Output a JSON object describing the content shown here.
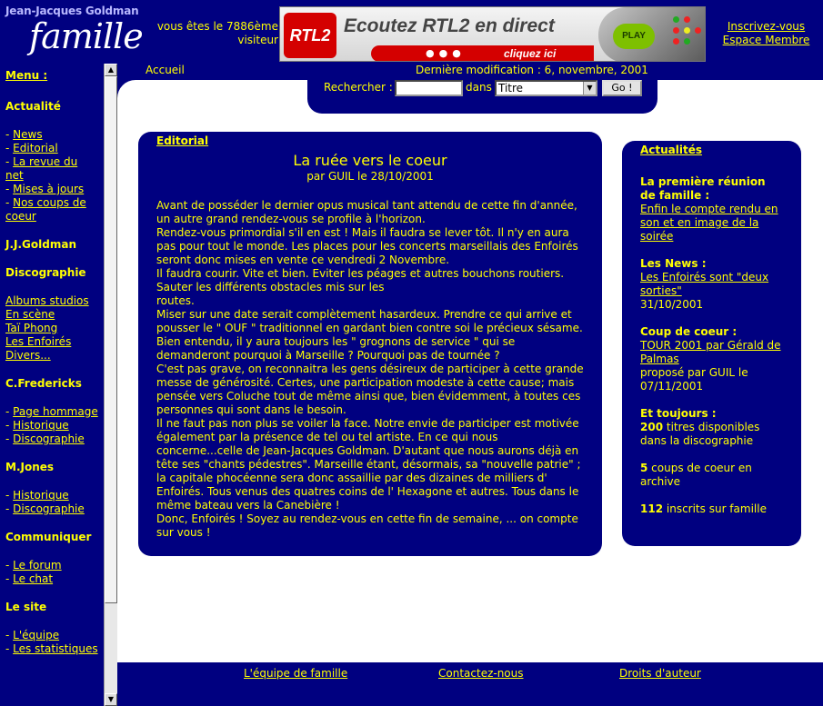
{
  "header": {
    "logo_top": "Jean-Jacques Goldman",
    "logo_main": "famille",
    "visitor_text": "vous êtes le 7886ème visiteur",
    "banner": {
      "logo": "RTL2",
      "headline": "Ecoutez RTL2 en direct",
      "cta": "cliquez ici",
      "play": "PLAY"
    },
    "member_links": [
      "Inscrivez-vous",
      "Espace Membre"
    ]
  },
  "sidebar": {
    "menu_title": "Menu :",
    "sections": [
      {
        "title": "Actualité",
        "items": [
          "News",
          "Editorial",
          "La revue du net",
          "Mises à jours",
          "Nos coups de coeur"
        ]
      },
      {
        "title": "J.J.Goldman",
        "items": []
      },
      {
        "title": "Discographie",
        "items": [
          "Albums studios",
          "En scène",
          "Taï Phong",
          "Les Enfoirés",
          "Divers..."
        ]
      },
      {
        "title": "C.Fredericks",
        "items": [
          "Page hommage",
          "Historique",
          "Discographie"
        ]
      },
      {
        "title": "M.Jones",
        "items": [
          "Historique",
          "Discographie"
        ]
      },
      {
        "title": "Communiquer",
        "items": [
          "Le forum",
          "Le chat"
        ]
      },
      {
        "title": "Le site",
        "items": [
          "L'équipe",
          "Les statistiques"
        ]
      }
    ]
  },
  "topbar": {
    "home": "Accueil",
    "last_modified": "Dernière modification : 6, novembre, 2001"
  },
  "search": {
    "label": "Rechercher :",
    "value": "",
    "dans_label": "dans",
    "field_selected": "Titre",
    "button": "Go !"
  },
  "editorial": {
    "section_label": "Editorial",
    "title": "La ruée vers le coeur",
    "byline": "par GUIL le 28/10/2001",
    "paragraphs": [
      "Avant de posséder le dernier opus musical tant attendu de cette fin d'année, un autre grand rendez-vous se profile à l'horizon.",
      "Rendez-vous primordial s'il en est ! Mais il faudra se lever tôt. Il n'y en aura pas pour tout le monde. Les places pour les concerts marseillais des Enfoirés seront donc mises en vente ce vendredi 2 Novembre.",
      "Il faudra courir. Vite et bien. Eviter les péages et autres bouchons routiers. Sauter les différents obstacles mis sur les",
      "routes.",
      "Miser sur une date serait complètement hasardeux. Prendre ce qui arrive et pousser le \" OUF \" traditionnel en gardant bien contre soi le précieux sésame.",
      "Bien entendu, il y aura toujours les \" grognons de service \" qui se demanderont pourquoi à Marseille ? Pourquoi pas de tournée ?",
      "C'est pas grave, on reconnaitra les gens désireux de participer à cette grande messe de générosité. Certes, une participation modeste à cette cause; mais pensée vers Coluche tout de même ainsi que, bien évidemment, à toutes ces personnes qui sont dans le besoin.",
      "Il ne faut pas non plus se voiler la face. Notre envie de participer est motivée également par la présence de tel ou tel artiste. En ce qui nous concerne...celle de Jean-Jacques Goldman. D'autant que nous aurons déjà en tête ses \"chants pédestres\". Marseille étant, désormais, sa \"nouvelle patrie\" ; la capitale phocéenne sera donc assaillie par des dizaines de milliers d' Enfoirés. Tous venus des quatres coins de l' Hexagone et autres. Tous dans le même bateau vers la Canebière !",
      "Donc, Enfoirés ! Soyez au rendez-vous en cette fin de semaine, ... on compte sur vous !"
    ]
  },
  "news": {
    "section_label": "Actualités",
    "items": [
      {
        "head": "La première réunion de famille :",
        "link": "Enfin le compte rendu en son et en image de la soirée",
        "text": ""
      },
      {
        "head": "Les News :",
        "link": "Les Enfoirés sont \"deux sorties\"",
        "text": "31/10/2001"
      },
      {
        "head": "Coup de coeur :",
        "link": "TOUR 2001 par Gérald de Palmas",
        "text": "proposé par GUIL le 07/11/2001"
      }
    ],
    "totals_head": "Et toujours :",
    "totals": [
      {
        "count": "200",
        "text": " titres disponibles dans la discographie"
      },
      {
        "count": "5",
        "text": " coups de coeur en archive"
      },
      {
        "count": "112",
        "text": " inscrits sur famille"
      }
    ]
  },
  "footer": {
    "links": [
      "L'équipe de famille",
      "Contactez-nous",
      "Droits d'auteur"
    ]
  }
}
